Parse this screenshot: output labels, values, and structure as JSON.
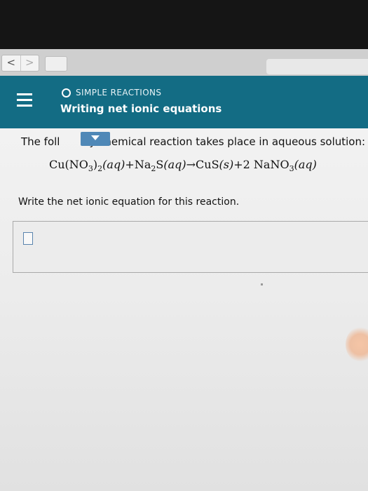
{
  "browser": {
    "back_label": "<",
    "forward_label": ">"
  },
  "header": {
    "topic": "SIMPLE REACTIONS",
    "title": "Writing net ionic equations"
  },
  "question": {
    "intro_prefix": "The foll",
    "intro_suffix": "y chemical reaction takes place in aqueous solution:",
    "equation": {
      "reactant1": "Cu",
      "reactant1_group": "(NO",
      "reactant1_sub1": "3",
      "reactant1_close": ")",
      "reactant1_sub2": "2",
      "reactant1_state": "(aq)",
      "plus1": "+",
      "reactant2": "Na",
      "reactant2_sub": "2",
      "reactant2_rest": "S",
      "reactant2_state": "(aq)",
      "arrow": "→",
      "product1": "CuS",
      "product1_state": "(s)",
      "plus2": "+",
      "coefficient": "2",
      "product2": "NaNO",
      "product2_sub": "3",
      "product2_state": "(aq)"
    },
    "prompt": "Write the net ionic equation for this reaction."
  }
}
